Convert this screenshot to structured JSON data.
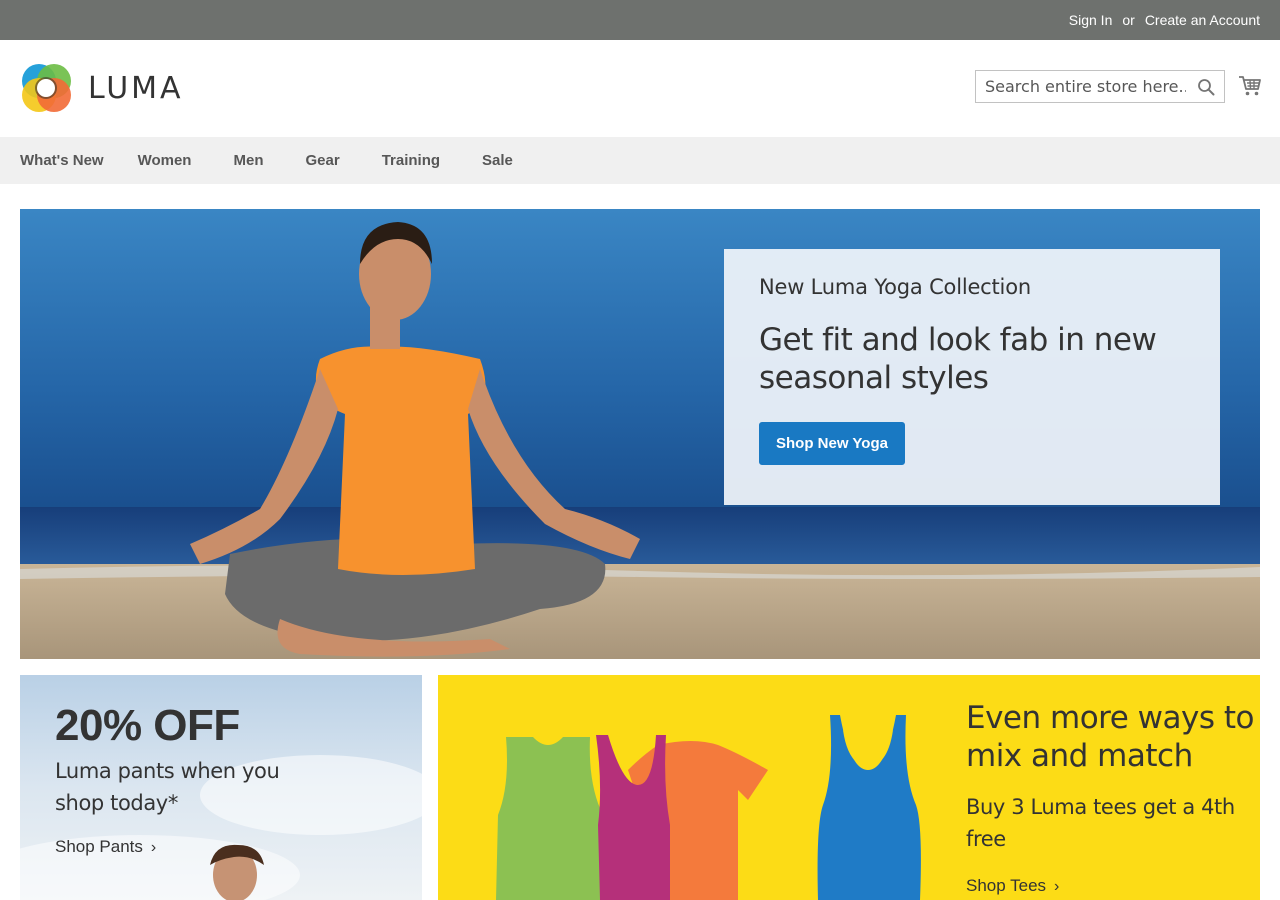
{
  "topbar": {
    "sign_in": "Sign In",
    "or": "or",
    "create_account": "Create an Account"
  },
  "header": {
    "logo_text": "LUMA",
    "search_placeholder": "Search entire store here...",
    "icons": [
      "search-icon",
      "cart-icon"
    ]
  },
  "nav": {
    "items": [
      {
        "label": "What's New"
      },
      {
        "label": "Women"
      },
      {
        "label": "Men"
      },
      {
        "label": "Gear"
      },
      {
        "label": "Training"
      },
      {
        "label": "Sale"
      }
    ]
  },
  "hero": {
    "eyebrow": "New Luma Yoga Collection",
    "headline": "Get fit and look fab in new seasonal styles",
    "button": "Shop New Yoga"
  },
  "promo_pants": {
    "big": "20% OFF",
    "sub": "Luma pants when you shop today*",
    "link": "Shop Pants",
    "chevron": "›"
  },
  "promo_tees": {
    "title": "Even more ways to mix and match",
    "sub": "Buy 3 Luma tees get a 4th free",
    "link": "Shop Tees",
    "chevron": "›"
  },
  "colors": {
    "topbar": "#6e716e",
    "accent_blue": "#1979c3",
    "promo_yellow": "#fcdc16",
    "nav_bg": "#f0f0f0"
  }
}
